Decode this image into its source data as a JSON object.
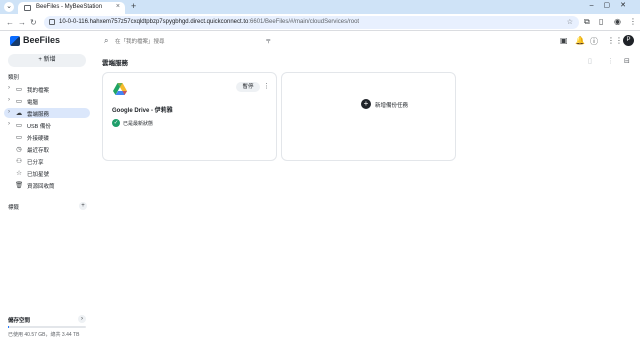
{
  "browser": {
    "tab_title": "BeeFiles - MyBeeStation",
    "tab_close": "×",
    "new_tab": "+",
    "window_controls": "–▢✕",
    "url_main": "10-0-0-116.hahxem757z57cxqldtpbzp7spygbhgd.direct.quickconnect.to",
    "url_tail": ":6601/BeeFiles/#/main/cloudServices/root"
  },
  "app": {
    "name": "BeeFiles",
    "search_placeholder": "在「我的檔案」搜尋",
    "user_initial": "P"
  },
  "sidebar": {
    "new_button": "+  新增",
    "section_label": "類別",
    "items": [
      {
        "label": "我的檔案",
        "icon": "folder-icon",
        "glyph": "▭"
      },
      {
        "label": "電腦",
        "icon": "computer-icon",
        "glyph": "▭"
      },
      {
        "label": "雲端服務",
        "icon": "cloud-icon",
        "glyph": "☁"
      },
      {
        "label": "USB 備份",
        "icon": "usb-icon",
        "glyph": "▭"
      },
      {
        "label": "外接硬碟",
        "icon": "external-drive-icon",
        "glyph": "▭"
      },
      {
        "label": "最近存取",
        "icon": "clock-icon",
        "glyph": "◷"
      },
      {
        "label": "已分享",
        "icon": "people-icon",
        "glyph": "⚇"
      },
      {
        "label": "已加星號",
        "icon": "star-icon",
        "glyph": "☆"
      },
      {
        "label": "資源回收筒",
        "icon": "trash-icon",
        "glyph": "🗑"
      }
    ],
    "tags_label": "標籤",
    "storage_title": "儲存空間",
    "storage_used_text": "已使用 40.57 GB，總共 3.44 TB",
    "storage_fraction": 0.012
  },
  "main": {
    "title": "雲端服務",
    "card": {
      "status_button": "暫停",
      "name": "Google Drive - 伊莉雅",
      "status": "已是最新狀態"
    },
    "add_task_label": "新增備份任務"
  }
}
